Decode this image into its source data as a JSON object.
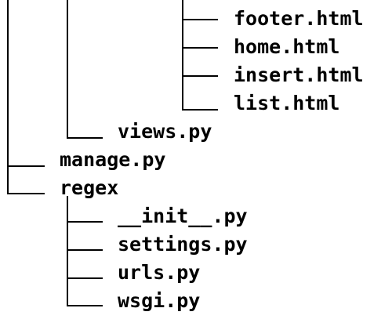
{
  "tree": {
    "nodes": [
      {
        "id": "footer",
        "name": "footer.html"
      },
      {
        "id": "home",
        "name": "home.html"
      },
      {
        "id": "insert",
        "name": "insert.html"
      },
      {
        "id": "list",
        "name": "list.html"
      },
      {
        "id": "views",
        "name": "views.py"
      },
      {
        "id": "manage",
        "name": "manage.py"
      },
      {
        "id": "regex",
        "name": "regex"
      },
      {
        "id": "init",
        "name": "__init__.py"
      },
      {
        "id": "settings",
        "name": "settings.py"
      },
      {
        "id": "urls",
        "name": "urls.py"
      },
      {
        "id": "wsgi",
        "name": "wsgi.py"
      }
    ]
  },
  "colors": {
    "text": "#000000",
    "lines": "#000000",
    "background": "#ffffff"
  }
}
